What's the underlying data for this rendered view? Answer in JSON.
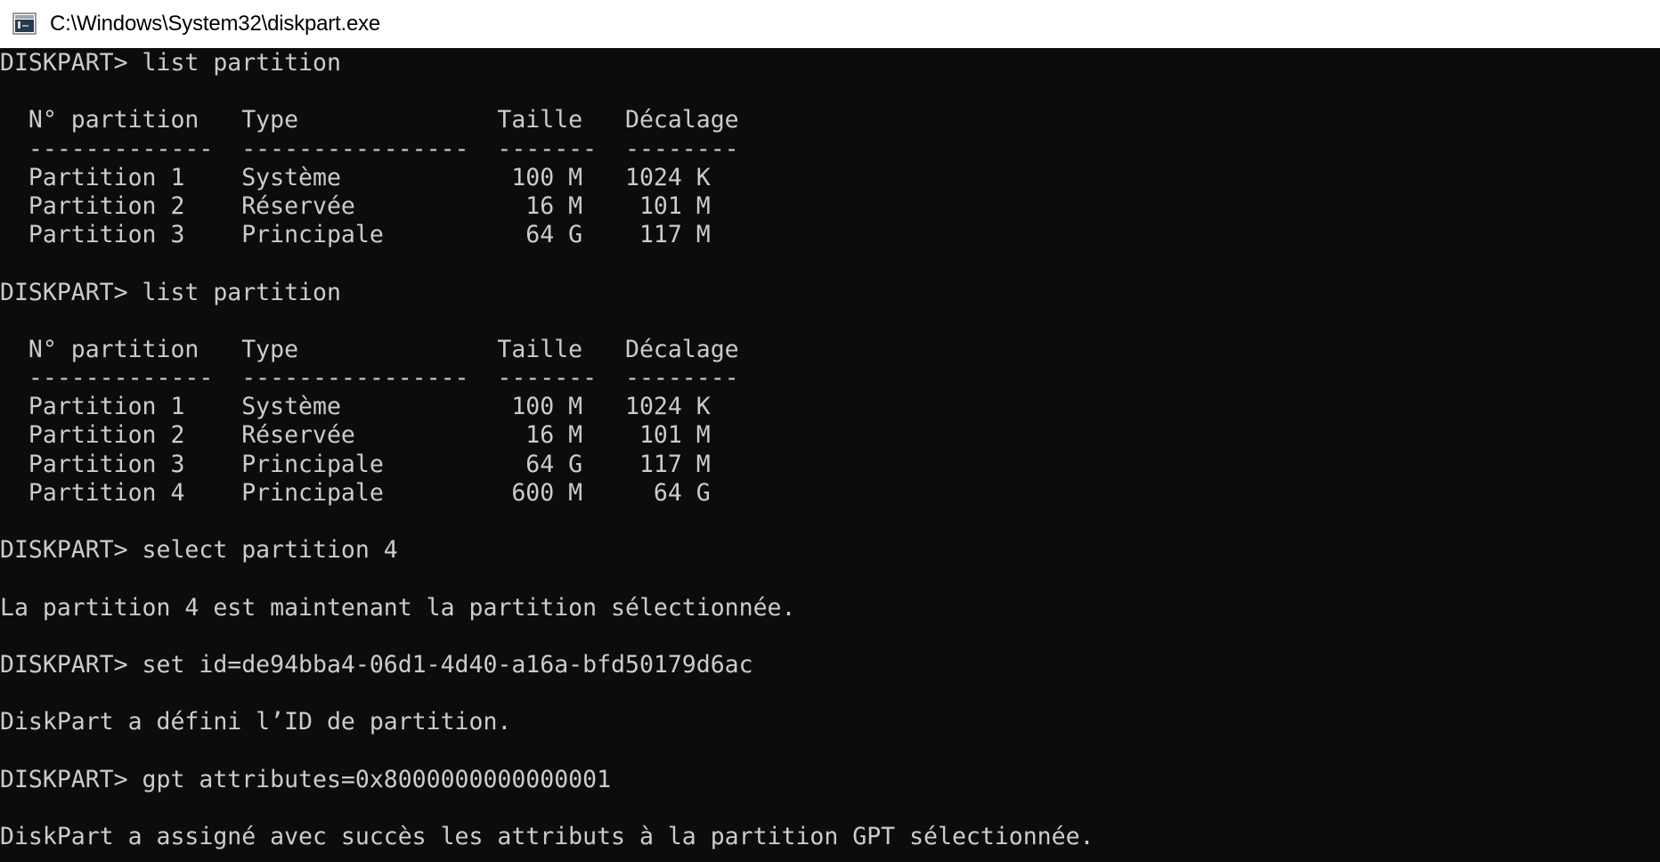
{
  "window": {
    "title": "C:\\Windows\\System32\\diskpart.exe",
    "icon": "console-app-icon"
  },
  "colors": {
    "console_background": "#0c0c0c",
    "console_text": "#cccccc",
    "titlebar_background": "#ffffff"
  },
  "console": {
    "lines": [
      "DISKPART> list partition",
      "",
      "  N° partition   Type              Taille   Décalage",
      "  -------------  ----------------  -------  --------",
      "  Partition 1    Système            100 M   1024 K",
      "  Partition 2    Réservée            16 M    101 M",
      "  Partition 3    Principale          64 G    117 M",
      "",
      "DISKPART> list partition",
      "",
      "  N° partition   Type              Taille   Décalage",
      "  -------------  ----------------  -------  --------",
      "  Partition 1    Système            100 M   1024 K",
      "  Partition 2    Réservée            16 M    101 M",
      "  Partition 3    Principale          64 G    117 M",
      "  Partition 4    Principale         600 M     64 G",
      "",
      "DISKPART> select partition 4",
      "",
      "La partition 4 est maintenant la partition sélectionnée.",
      "",
      "DISKPART> set id=de94bba4-06d1-4d40-a16a-bfd50179d6ac",
      "",
      "DiskPart a défini l’ID de partition.",
      "",
      "DISKPART> gpt attributes=0x8000000000000001",
      "",
      "DiskPart a assigné avec succès les attributs à la partition GPT sélectionnée.",
      ""
    ]
  }
}
